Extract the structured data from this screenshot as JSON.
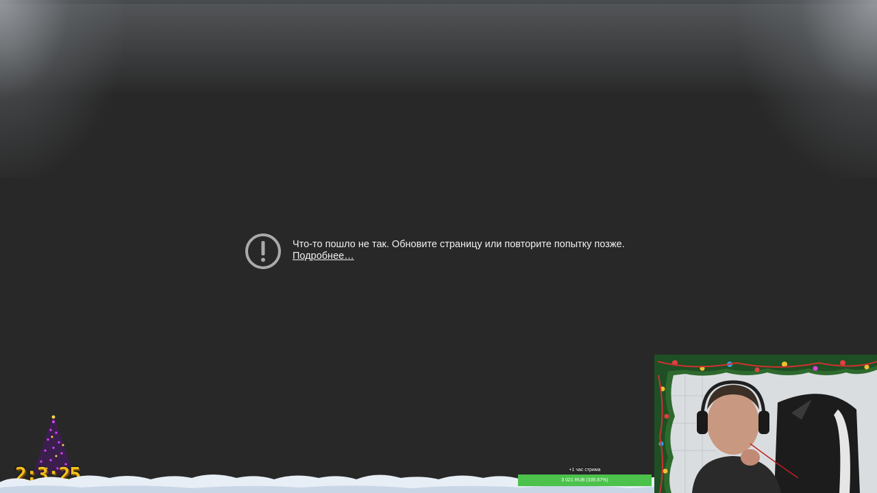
{
  "error": {
    "message": "Что-то пошло не так. Обновите страницу или повторите попытку позже.",
    "link": "Подробнее…"
  },
  "overlay": {
    "timer": "2:3:25",
    "subathon_label": "+1 час стрима",
    "subathon_progress": "3 021 RUB (335.67%)",
    "subathon_fill_fraction": 1.0
  },
  "icons": {
    "error": "exclamation-circle-icon",
    "tree": "christmas-tree-icon"
  },
  "colors": {
    "background": "#282828",
    "text": "#f1f1f1",
    "icon": "#aaaaaa",
    "timer": "#f2c020",
    "progress_fill": "#4cc24c"
  }
}
